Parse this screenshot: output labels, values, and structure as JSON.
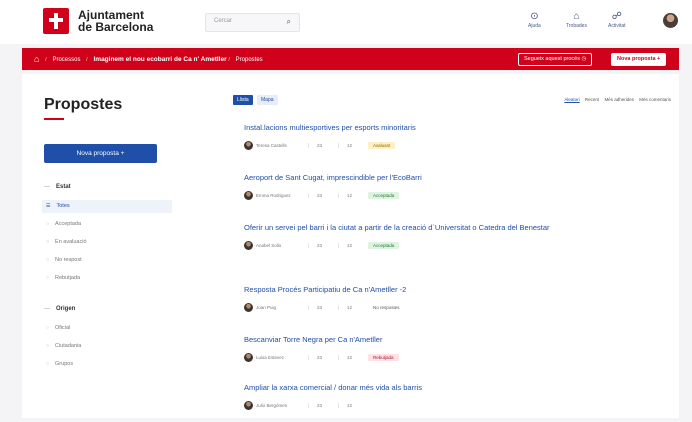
{
  "header": {
    "brand_line1": "Ajuntament",
    "brand_line2": "de Barcelona",
    "search_placeholder": "Cercar",
    "nav": [
      {
        "label": "Ajuda",
        "icon": "help-icon"
      },
      {
        "label": "Trobades",
        "icon": "bell-icon"
      },
      {
        "label": "Activitat",
        "icon": "activity-icon"
      }
    ]
  },
  "breadcrumb": {
    "items": [
      "Processos",
      "Imaginem el nou ecobarri de Ca n' Ametller",
      "Propostes"
    ],
    "follow_label": "Segueix aquest procés",
    "new_label": "Nova proposta"
  },
  "sidebar": {
    "title": "Propostes",
    "new_button": "Nova proposta",
    "state_heading": "Estat",
    "states": [
      "Totes",
      "Acceptada",
      "En avaluació",
      "No respost",
      "Rebutjada"
    ],
    "origin_heading": "Origen",
    "origins": [
      "Oficial",
      "Ciutadania",
      "Grupos"
    ]
  },
  "main": {
    "tabs": [
      "Llista",
      "Mapa"
    ],
    "sorts": [
      "Aleatori",
      "Recent",
      "Més adherides",
      "Més comentaris"
    ],
    "items": [
      {
        "title": "Instal.lacions multiesportives per esports minoritaris",
        "author": "Teresa Castells",
        "votes": "23",
        "comments": "12",
        "status": "Avaluant",
        "status_bg": "#fdf0c4",
        "status_fg": "#8a6d00"
      },
      {
        "title": "Aeroport de Sant Cugat, imprescindible per l'EcoBarri",
        "author": "Emma Rodriguez",
        "votes": "23",
        "comments": "12",
        "status": "Acceptada",
        "status_bg": "#dff3e2",
        "status_fg": "#1e7b34"
      },
      {
        "title": "Oferir un servei pel barri i la ciutat a partir de la creació d´Universitat o Catedra del Benestar",
        "author": "Anabel Sollo",
        "votes": "23",
        "comments": "12",
        "status": "Acceptada",
        "status_bg": "#dff3e2",
        "status_fg": "#1e7b34"
      },
      {
        "title": "Resposta Procés Participatiu de Ca n'Ametller -2",
        "author": "Joan Puig",
        "votes": "23",
        "comments": "12",
        "status": "No respostes",
        "status_bg": "#ffffff",
        "status_fg": "#555555"
      },
      {
        "title": "Bescanviar Torre Negra per Ca n'Ametller",
        "author": "Luisa Estevez",
        "votes": "23",
        "comments": "12",
        "status": "Rebutjada",
        "status_bg": "#fde1e5",
        "status_fg": "#b3122e"
      },
      {
        "title": "Ampliar la xarxa comercial / donar més vida als barris",
        "author": "Julio Bergómen",
        "votes": "23",
        "comments": "12",
        "status": "",
        "status_bg": "#ffffff",
        "status_fg": "#555555"
      }
    ]
  }
}
